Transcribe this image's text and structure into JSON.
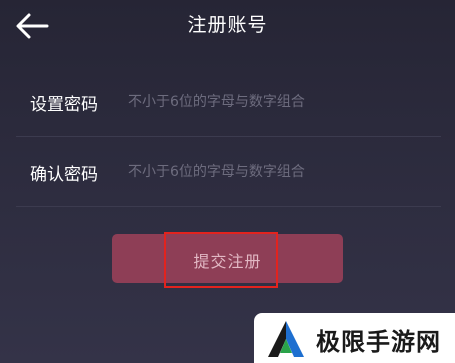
{
  "header": {
    "title": "注册账号",
    "back_icon": "arrow-left-icon"
  },
  "form": {
    "set_password": {
      "label": "设置密码",
      "placeholder": "不小于6位的字母与数字组合",
      "value": ""
    },
    "confirm_password": {
      "label": "确认密码",
      "placeholder": "不小于6位的字母与数字组合",
      "value": ""
    },
    "submit_label": "提交注册"
  },
  "annotation": {
    "highlight_color": "#e3231e"
  },
  "watermark": {
    "text": "极限手游网"
  },
  "colors": {
    "background": "#2b2a3c",
    "button": "#8e3e56",
    "button_text": "#e2b8c4",
    "placeholder": "#6d6c7e"
  }
}
